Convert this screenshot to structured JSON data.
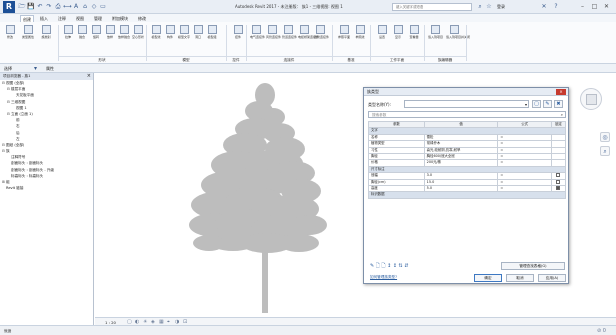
{
  "titlebar": {
    "app_title": "Autodesk Revit 2017 - 未注册版：  族1 - 三维视图: 视图 1",
    "search_placeholder": "键入关键字或短语",
    "login_label": "登录",
    "help_label": "?"
  },
  "menu": {
    "tabs": [
      "创建",
      "插入",
      "注释",
      "视图",
      "管理",
      "附加模块",
      "修改"
    ]
  },
  "ribbon": {
    "buttons": [
      "修改",
      "类型属性",
      "族类别",
      "拉伸",
      "融合",
      "旋转",
      "放样",
      "放样融合",
      "空心形状",
      "模型线",
      "构件",
      "模型文字",
      "洞口",
      "模型组",
      "参照平面",
      "参照线",
      "电气连接件",
      "风管连接件",
      "管道连接件",
      "电缆桥架连接件",
      "线管连接件",
      "参照",
      "平面",
      "控件",
      "设置",
      "显示",
      "查看器",
      "载入到项目",
      "载入到项目并关闭"
    ],
    "groups": [
      "选择",
      "属性",
      "形状",
      "模型",
      "控件",
      "连接件",
      "基准",
      "工作平面",
      "族编辑器"
    ]
  },
  "selector_bar": {
    "select_label": "选择",
    "properties_label": "属性"
  },
  "browser": {
    "title": "项目浏览器 - 族1",
    "close": "×",
    "items": [
      {
        "toggle": "⊟",
        "label": "视图 (全部)"
      },
      {
        "toggle": "⊟",
        "label": "楼层平面"
      },
      {
        "toggle": "",
        "label": "天花板平面"
      },
      {
        "toggle": "⊟",
        "label": "三维视图"
      },
      {
        "toggle": "",
        "label": "视图 1"
      },
      {
        "toggle": "⊟",
        "label": "立面 (立面 1)"
      },
      {
        "toggle": "",
        "label": "前"
      },
      {
        "toggle": "",
        "label": "右"
      },
      {
        "toggle": "",
        "label": "后"
      },
      {
        "toggle": "",
        "label": "左"
      },
      {
        "toggle": "⊟",
        "label": "图纸 (全部)"
      },
      {
        "toggle": "⊟",
        "label": "族"
      },
      {
        "toggle": "",
        "label": "注释符号"
      },
      {
        "toggle": "",
        "label": "剖面标头 : 剖面标头"
      },
      {
        "toggle": "",
        "label": "剖面标头 : 剖面标头 - 升级"
      },
      {
        "toggle": "",
        "label": "标高标头 : 标高标头"
      },
      {
        "toggle": "⊞",
        "label": "组"
      },
      {
        "toggle": "",
        "label": "Revit 链接"
      }
    ]
  },
  "view_controls": {
    "scale": "1 : 20",
    "icons": [
      "▢",
      "◐",
      "☀",
      "◈",
      "▦",
      "⌖",
      "◑",
      "⊡"
    ]
  },
  "status": {
    "text": "就绪",
    "right": "⊘  0"
  },
  "dialog": {
    "title": "族类型",
    "close": "×",
    "type_name_label": "类型名称(Y):",
    "type_name_value": "",
    "search_placeholder": "搜索参数",
    "table": {
      "headers": [
        "参数",
        "值",
        "公式",
        "锁定"
      ],
      "groups": [
        {
          "name": "文字",
          "rows": [
            {
              "param": "名称",
              "value": "雪松",
              "formula": "=",
              "lock": ""
            },
            {
              "param": "植物类型",
              "value": "常绿乔木",
              "formula": "=",
              "lock": ""
            },
            {
              "param": "习性",
              "value": "喜光,较耐阴,抗寒,耐旱",
              "formula": "=",
              "lock": ""
            },
            {
              "param": "胸径",
              "value": "胸径600/冠大全冠",
              "formula": "=",
              "lock": ""
            },
            {
              "param": "价格",
              "value": "200元/株",
              "formula": "=",
              "lock": ""
            }
          ]
        },
        {
          "name": "尺寸标注",
          "rows": [
            {
              "param": "冠幅",
              "value": "3.0",
              "formula": "=",
              "lock": "off"
            },
            {
              "param": "胸径(cm)",
              "value": "15.0",
              "formula": "=",
              "lock": "off"
            },
            {
              "param": "高度",
              "value": "5.0",
              "formula": "=",
              "lock": "on"
            }
          ]
        },
        {
          "name": "标识数据",
          "rows": []
        }
      ]
    },
    "tool_icons": "✎ 🗋 🗋 ↕ ↕ ⇅ ⇵",
    "manage_lookup_label": "管理查找表格(G)",
    "howto_link": "如何管理族类型?",
    "ok_label": "确定",
    "cancel_label": "取消",
    "apply_label": "应用(A)"
  },
  "colors": {
    "tree_fill": "#bdbdbd",
    "accent": "#1c4f96",
    "close_red": "#c63a2e"
  }
}
